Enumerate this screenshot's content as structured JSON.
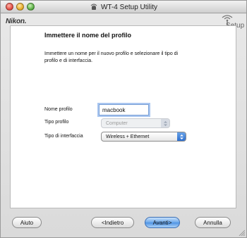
{
  "window": {
    "title": "WT-4 Setup Utility"
  },
  "header": {
    "brand": "Nikon.",
    "setup_label": "Setup"
  },
  "page": {
    "heading": "Immettere il nome del profilo",
    "description": "Immettere un nome per il nuovo profilo e selezionare il tipo di profilo e di interfaccia."
  },
  "form": {
    "profile_name_label": "Nome profilo",
    "profile_name_value": "macbook",
    "profile_type_label": "Tipo profilo",
    "profile_type_value": "Computer",
    "interface_type_label": "Tipo di interfaccia",
    "interface_type_value": "Wireless + Ethernet"
  },
  "buttons": {
    "help": "Aiuto",
    "back": "<Indietro",
    "next": "Avanti>",
    "cancel": "Annulla"
  },
  "colors": {
    "accent": "#4d93e4",
    "focus_ring": "#a9c6f0"
  }
}
